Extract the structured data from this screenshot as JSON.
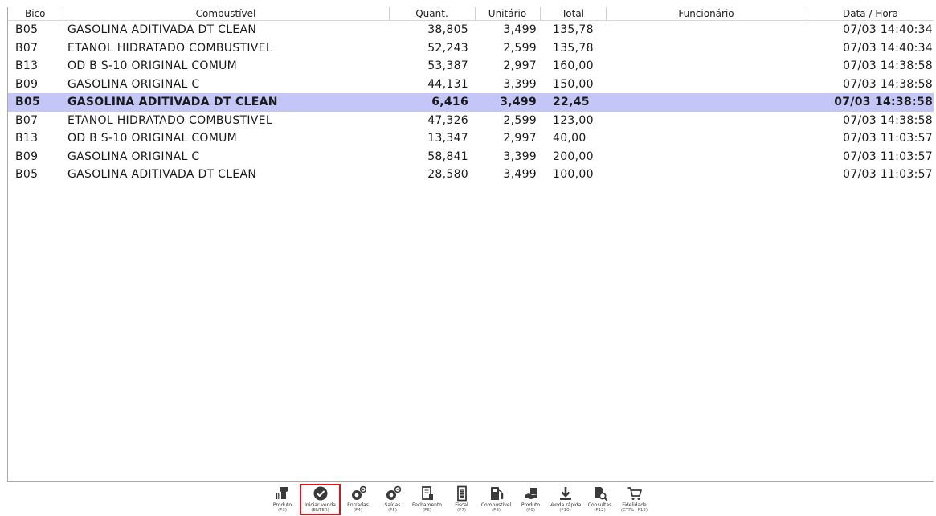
{
  "columns": {
    "bico": "Bico",
    "combustivel": "Combustível",
    "quant": "Quant.",
    "unitario": "Unitário",
    "total": "Total",
    "funcionario": "Funcionário",
    "datahora": "Data / Hora"
  },
  "rows": [
    {
      "bico": "B05",
      "combustivel": "GASOLINA ADITIVADA DT CLEAN",
      "quant": "38,805",
      "unitario": "3,499",
      "total": "135,78",
      "funcionario": "",
      "datahora": "07/03 14:40:34",
      "selected": false
    },
    {
      "bico": "B07",
      "combustivel": "ETANOL HIDRATADO COMBUSTIVEL",
      "quant": "52,243",
      "unitario": "2,599",
      "total": "135,78",
      "funcionario": "",
      "datahora": "07/03 14:40:34",
      "selected": false
    },
    {
      "bico": "B13",
      "combustivel": "OD B S-10 ORIGINAL COMUM",
      "quant": "53,387",
      "unitario": "2,997",
      "total": "160,00",
      "funcionario": "",
      "datahora": "07/03 14:38:58",
      "selected": false
    },
    {
      "bico": "B09",
      "combustivel": "GASOLINA ORIGINAL C",
      "quant": "44,131",
      "unitario": "3,399",
      "total": "150,00",
      "funcionario": "",
      "datahora": "07/03 14:38:58",
      "selected": false
    },
    {
      "bico": "B05",
      "combustivel": "GASOLINA ADITIVADA DT CLEAN",
      "quant": "6,416",
      "unitario": "3,499",
      "total": "22,45",
      "funcionario": "",
      "datahora": "07/03 14:38:58",
      "selected": true
    },
    {
      "bico": "B07",
      "combustivel": "ETANOL HIDRATADO COMBUSTIVEL",
      "quant": "47,326",
      "unitario": "2,599",
      "total": "123,00",
      "funcionario": "",
      "datahora": "07/03 14:38:58",
      "selected": false
    },
    {
      "bico": "B13",
      "combustivel": "OD B S-10 ORIGINAL COMUM",
      "quant": "13,347",
      "unitario": "2,997",
      "total": "40,00",
      "funcionario": "",
      "datahora": "07/03 11:03:57",
      "selected": false
    },
    {
      "bico": "B09",
      "combustivel": "GASOLINA ORIGINAL C",
      "quant": "58,841",
      "unitario": "3,399",
      "total": "200,00",
      "funcionario": "",
      "datahora": "07/03 11:03:57",
      "selected": false
    },
    {
      "bico": "B05",
      "combustivel": "GASOLINA ADITIVADA DT CLEAN",
      "quant": "28,580",
      "unitario": "3,499",
      "total": "100,00",
      "funcionario": "",
      "datahora": "07/03 11:03:57",
      "selected": false
    }
  ],
  "toolbar": [
    {
      "id": "produto-f3",
      "label": "Produto",
      "key": "(F3)",
      "icon": "barcode-scanner-icon",
      "active": false
    },
    {
      "id": "iniciar-venda",
      "label": "Iniciar venda",
      "key": "(ENTER)",
      "icon": "check-circle-icon",
      "active": true
    },
    {
      "id": "entradas",
      "label": "Entradas",
      "key": "(F4)",
      "icon": "coins-in-icon",
      "active": false
    },
    {
      "id": "saidas",
      "label": "Saídas",
      "key": "(F5)",
      "icon": "coins-out-icon",
      "active": false
    },
    {
      "id": "fechamento",
      "label": "Fechamento",
      "key": "(F6)",
      "icon": "closing-report-icon",
      "active": false
    },
    {
      "id": "fiscal",
      "label": "Fiscal",
      "key": "(F7)",
      "icon": "fiscal-receipt-icon",
      "active": false
    },
    {
      "id": "combustivel",
      "label": "Combustível",
      "key": "(F8)",
      "icon": "fuel-pump-icon",
      "active": false
    },
    {
      "id": "produto-f9",
      "label": "Produto",
      "key": "(F9)",
      "icon": "box-hand-icon",
      "active": false
    },
    {
      "id": "venda-rapida",
      "label": "Venda rápida",
      "key": "(F10)",
      "icon": "download-arrow-icon",
      "active": false
    },
    {
      "id": "consultas",
      "label": "Consultas",
      "key": "(F12)",
      "icon": "document-search-icon",
      "active": false
    },
    {
      "id": "fidelidade",
      "label": "Fidelidade",
      "key": "(CTRL+F12)",
      "icon": "shopping-cart-icon",
      "active": false
    }
  ],
  "colors": {
    "selected_row": "#c3c6f6",
    "active_button_outline": "#e0131c",
    "icon": "#3a3a3a"
  }
}
